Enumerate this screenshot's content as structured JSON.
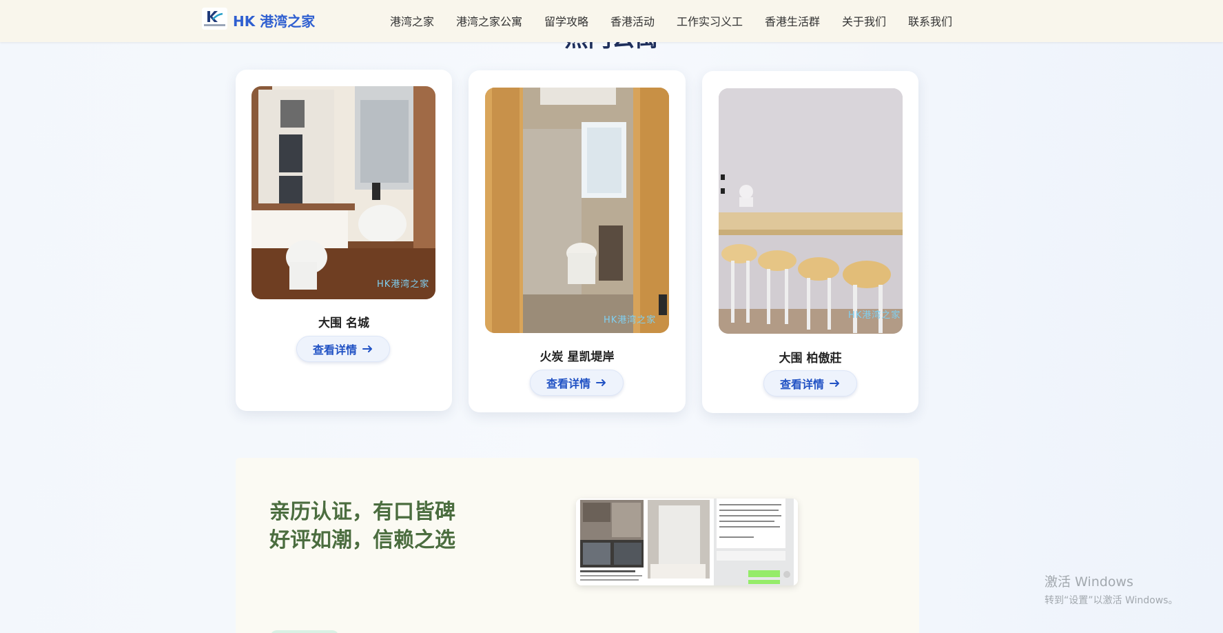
{
  "nav": {
    "brand": "HK 港湾之家",
    "items": [
      "港湾之家",
      "港湾之家公寓",
      "留学攻略",
      "香港活动",
      "工作实习义工",
      "香港生活群",
      "关于我们",
      "联系我们"
    ]
  },
  "section": {
    "title": "热门公寓"
  },
  "cards": [
    {
      "name": "大围 名城",
      "button": "查看详情",
      "watermark": "HK港湾之家"
    },
    {
      "name": "火炭 星凯堤岸",
      "button": "查看详情",
      "watermark": "HK港湾之家"
    },
    {
      "name": "大围 柏傲莊",
      "button": "查看详情",
      "watermark": "HK港湾之家"
    }
  ],
  "testimonial": {
    "heading_line1": "亲历认证，有口皆碑",
    "heading_line2": "好评如潮，信赖之选"
  },
  "windows": {
    "title": "激活 Windows",
    "subtitle": "转到“设置”以激活 Windows。"
  },
  "colors": {
    "brand": "#2f5fd0",
    "nav_bg": "#f9f6ec",
    "button_text": "#2152c4",
    "testimonial_heading": "#4b6d3f"
  },
  "icons": {
    "logo": "hk-logo-icon",
    "button_arrow": "arrow-right-icon"
  }
}
